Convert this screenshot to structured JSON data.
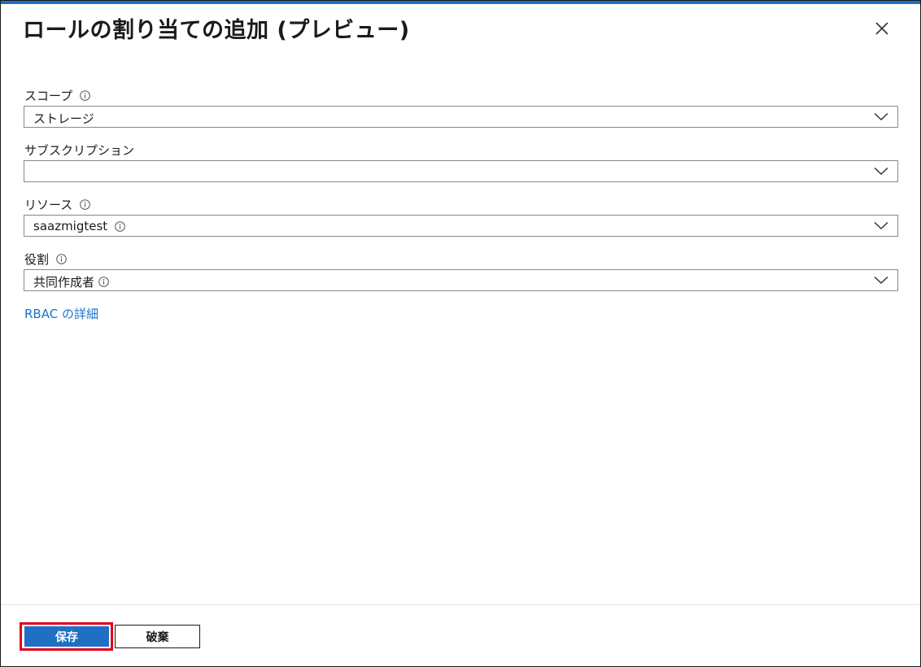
{
  "panel": {
    "title": "ロールの割り当ての追加 (プレビュー)",
    "close_icon": "close-icon"
  },
  "fields": {
    "scope": {
      "label": "スコープ",
      "value": "ストレージ",
      "has_info_icon": true
    },
    "subscription": {
      "label": "サブスクリプション",
      "value": "",
      "has_info_icon": false
    },
    "resource": {
      "label": "リソース",
      "value": "saazmigtest",
      "has_info_icon": true,
      "value_has_info_icon": true
    },
    "role": {
      "label": "役割",
      "value": "共同作成者",
      "has_info_icon": true,
      "value_has_info_icon": true
    }
  },
  "links": {
    "rbac_details": "RBAC の詳細"
  },
  "footer": {
    "save_label": "保存",
    "discard_label": "破棄"
  },
  "colors": {
    "accent": "#1f6fc4",
    "link": "#1a73c9",
    "highlight_outline": "#e0001a"
  }
}
